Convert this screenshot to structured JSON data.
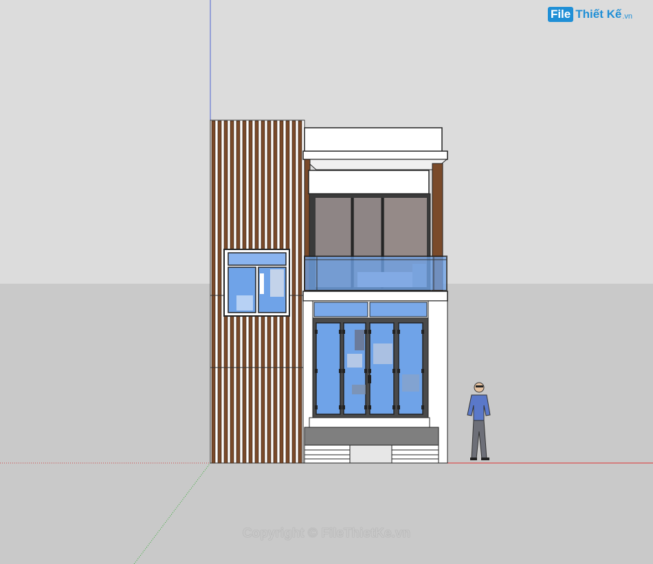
{
  "scene": {
    "sky_color": "#dcdcdc",
    "ground_color": "#c8c8c8",
    "wood_color": "#7a4a2a",
    "glass_color": "#6fa3e8"
  },
  "logo": {
    "box": "File",
    "text": "Thiết Kế",
    "suffix": ".vn"
  },
  "watermark": "Copyright © FileThietKe.vn"
}
